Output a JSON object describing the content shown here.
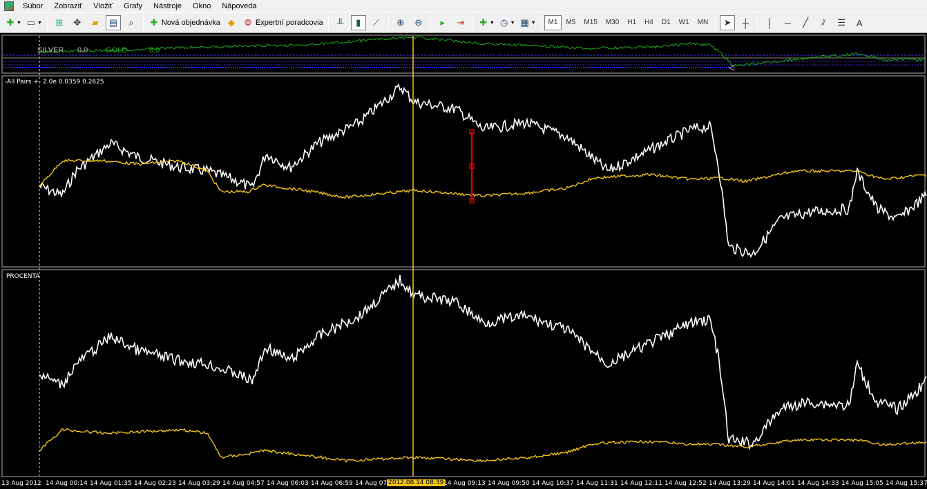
{
  "menu": {
    "items": [
      "Súbor",
      "Zobraziť",
      "Vložiť",
      "Grafy",
      "Nástroje",
      "Okno",
      "Nápoveda"
    ]
  },
  "toolbar": {
    "new_order_label": "Nová objednávka",
    "expert_label": "Expertní poradcovia",
    "timeframes": [
      "M1",
      "M5",
      "M15",
      "M30",
      "H1",
      "H4",
      "D1",
      "W1",
      "MN"
    ],
    "active_timeframe": "M1",
    "text_tool_label": "A"
  },
  "top_panel": {
    "silver_label": "SILVER",
    "silver_value": "0.0",
    "gold_label": "GOLD",
    "gold_value": "0.9"
  },
  "middle_panel": {
    "label": "-All Pairs +- 2.0e 0.0359 0.2625"
  },
  "bottom_panel": {
    "label": "PROCENTA"
  },
  "time_axis": {
    "labels": [
      "13 Aug 2012",
      "14 Aug 00:14",
      "14 Aug 01:35",
      "14 Aug 02:23",
      "14 Aug 03:29",
      "14 Aug 04:57",
      "14 Aug 06:03",
      "14 Aug 06:59",
      "14 Aug 07:",
      "14 Aug 09:13",
      "14 Aug 09:50",
      "14 Aug 10:37",
      "14 Aug 11:31",
      "14 Aug 12:11",
      "14 Aug 12:52",
      "14 Aug 13:29",
      "14 Aug 14:01",
      "14 Aug 14:33",
      "14 Aug 15:05",
      "14 Aug 15:37"
    ],
    "highlight": "2012.08.14 08:39"
  },
  "colors": {
    "white_series": "#ffffff",
    "gold_series": "#f5c518",
    "green_series": "#22aa22",
    "blue_series": "#2222ff",
    "cursor_line": "#f5c518",
    "red_marker": "#dd0000"
  }
}
